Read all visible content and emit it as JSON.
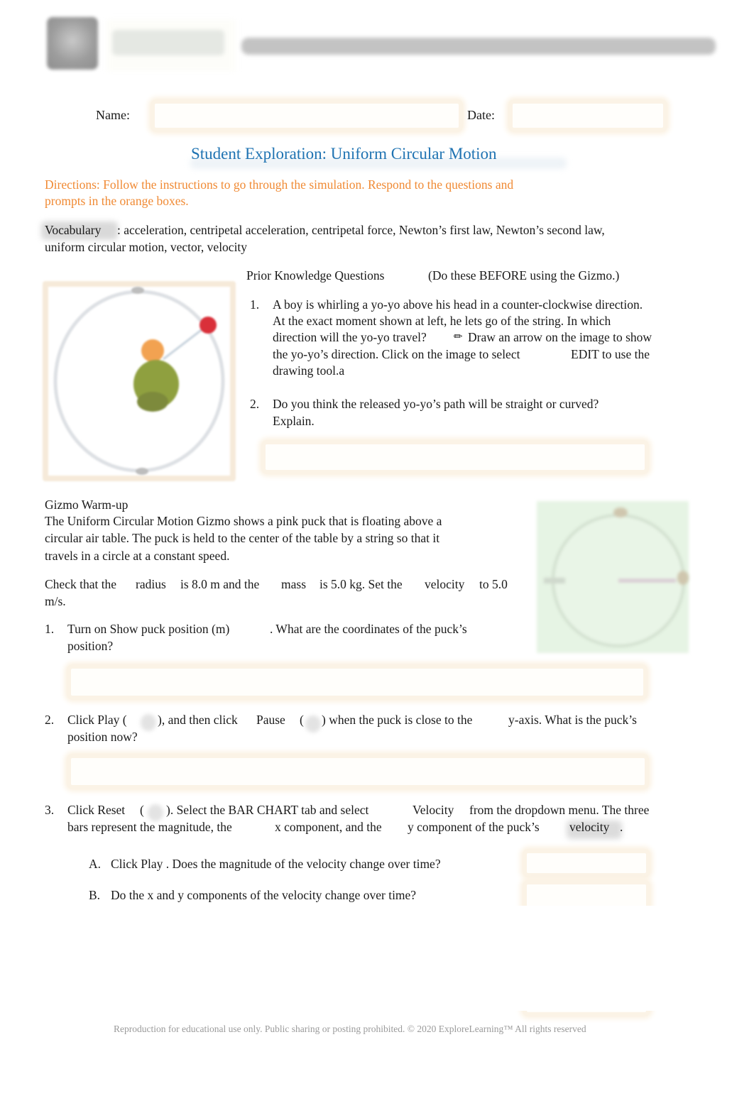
{
  "header": {
    "logo_icon": "gizmos-logo-icon",
    "logo_text": "Gizmos"
  },
  "form": {
    "name_label": "Name:",
    "name_value": "",
    "date_label": "Date:",
    "date_value": ""
  },
  "title": "Student Exploration: Uniform Circular Motion",
  "directions": {
    "line1": "Directions: Follow the instructions to go through the simulation. Respond to the questions and",
    "line2": "prompts in the orange boxes."
  },
  "vocabulary": {
    "label": "Vocabulary",
    "line1": ": acceleration, centripetal acceleration, centripetal force, Newton’s first law, Newton’s second law,",
    "line2": "uniform circular motion, vector, velocity"
  },
  "prior_knowledge": {
    "heading": "Prior Knowledge Questions",
    "note": "(Do these BEFORE using the Gizmo.)",
    "image_icon": "boy-whirling-yoyo-image",
    "questions": [
      {
        "number": "1.",
        "lines": [
          "A boy is whirling a yo-yo above his head in a counter-clockwise direction.",
          "At the exact moment shown at left, he lets go of the string. In which",
          "direction will the yo-yo travel?",
          "Draw an arrow on the image to show",
          "the yo-yo’s direction. Click on the image to select",
          "EDIT to use the",
          "drawing tool.a"
        ],
        "pencil_glyph": "✏"
      },
      {
        "number": "2.",
        "lines": [
          "Do you think the released yo-yo’s path will be straight or curved?",
          "Explain."
        ],
        "answer": ""
      }
    ]
  },
  "warmup": {
    "heading": "Gizmo Warm-up",
    "intro_lines": [
      "The  Uniform Circular Motion  Gizmo shows a pink puck that is floating above a",
      "circular air table. The puck is held to the center of the table by a string so that it",
      "travels in a circle at a constant speed."
    ],
    "check_line1": {
      "a": "Check that the",
      "b": "radius",
      "c": "is 8.0 m and the",
      "d": "mass",
      "e": "is 5.0 kg. Set the",
      "f": "velocity",
      "g": "to 5.0"
    },
    "check_line2": "m/s.",
    "image_icon": "air-table-puck-image",
    "questions": [
      {
        "number": "1.",
        "line1a": "Turn on  Show puck position (m)",
        "line1b": ". What are the coordinates of the puck’s",
        "line2": "position?",
        "answer": ""
      },
      {
        "number": "2.",
        "a": "Click Play  (",
        "b": "), and then click",
        "c": "Pause",
        "d": "(",
        "e": ") when the puck is close to the",
        "f": "y-axis. What is the puck’s",
        "line2": "position now?",
        "answer": ""
      },
      {
        "number": "3.",
        "a": "Click Reset",
        "b": "(",
        "c": "). Select the BAR CHART tab and select",
        "d": "Velocity",
        "e": "from the dropdown menu. The three",
        "line2a": "bars represent the magnitude, the",
        "line2b": "x component, and the",
        "line2c": "y component of the puck’s",
        "line2d": "velocity",
        "line2e": ".",
        "sub": [
          {
            "letter": "A.",
            "text": "Click Play . Does the magnitude of the velocity change over time?",
            "answer": ""
          },
          {
            "letter": "B.",
            "text": "Do the  x and  y components of the velocity change over time?",
            "answer": ""
          }
        ]
      }
    ]
  },
  "footer": "Reproduction for educational use only. Public sharing or posting prohibited. © 2020 ExploreLearning™ All rights reserved"
}
